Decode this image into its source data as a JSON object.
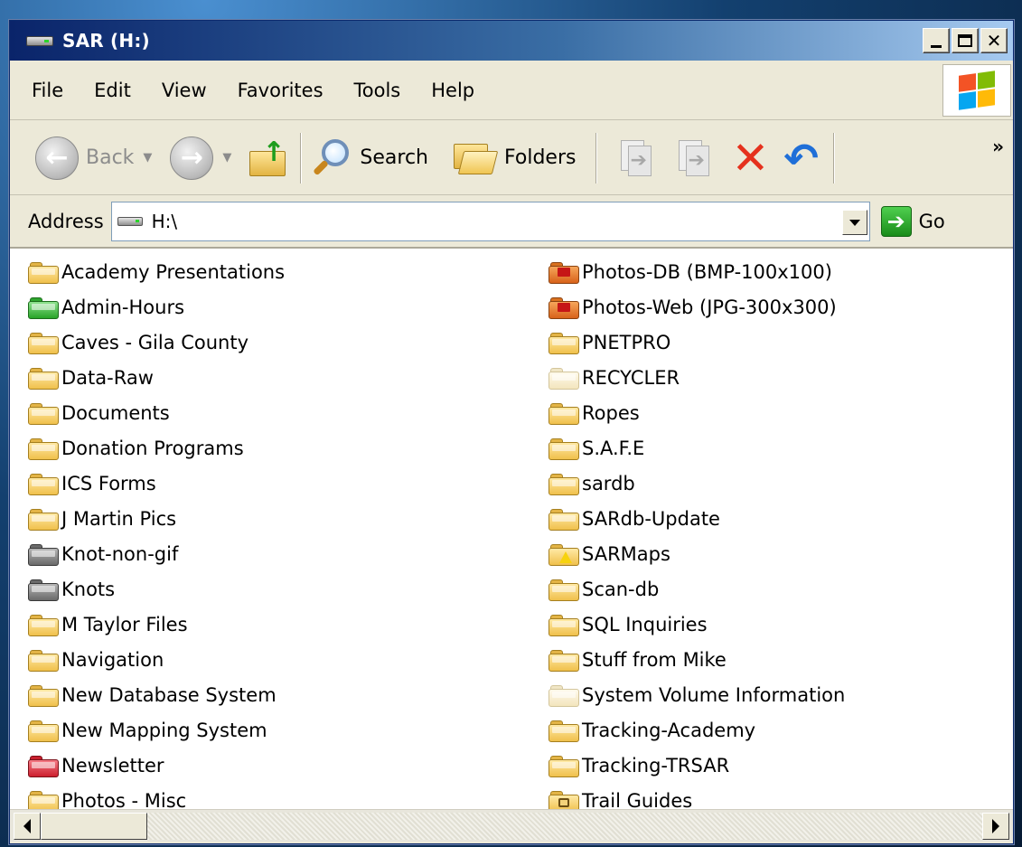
{
  "window": {
    "title": "SAR (H:)"
  },
  "menu": [
    "File",
    "Edit",
    "View",
    "Favorites",
    "Tools",
    "Help"
  ],
  "toolbar": {
    "back": "Back",
    "search": "Search",
    "folders": "Folders",
    "more": "»"
  },
  "address": {
    "label": "Address",
    "path": "H:\\",
    "go": "Go"
  },
  "folders_left": [
    {
      "name": "Academy Presentations",
      "icon": "folder-icon"
    },
    {
      "name": "Admin-Hours",
      "icon": "green-folder-icon"
    },
    {
      "name": "Caves - Gila County",
      "icon": "folder-icon"
    },
    {
      "name": "Data-Raw",
      "icon": "folder-icon"
    },
    {
      "name": "Documents",
      "icon": "folder-icon"
    },
    {
      "name": "Donation Programs",
      "icon": "folder-icon"
    },
    {
      "name": "ICS Forms",
      "icon": "folder-icon"
    },
    {
      "name": "J Martin Pics",
      "icon": "folder-icon"
    },
    {
      "name": "Knot-non-gif",
      "icon": "gray-folder-icon"
    },
    {
      "name": "Knots",
      "icon": "gray-folder-icon"
    },
    {
      "name": "M Taylor Files",
      "icon": "folder-icon"
    },
    {
      "name": "Navigation",
      "icon": "folder-icon"
    },
    {
      "name": "New Database System",
      "icon": "folder-icon"
    },
    {
      "name": "New Mapping System",
      "icon": "folder-icon"
    },
    {
      "name": "Newsletter",
      "icon": "red-folder-icon"
    },
    {
      "name": "Photos - Misc",
      "icon": "folder-icon"
    }
  ],
  "folders_right": [
    {
      "name": "Photos-DB (BMP-100x100)",
      "icon": "photo-folder-icon"
    },
    {
      "name": "Photos-Web (JPG-300x300)",
      "icon": "photo-folder-icon"
    },
    {
      "name": "PNETPRO",
      "icon": "folder-icon"
    },
    {
      "name": "RECYCLER",
      "icon": "hidden-folder-icon"
    },
    {
      "name": "Ropes",
      "icon": "folder-icon"
    },
    {
      "name": "S.A.F.E",
      "icon": "folder-icon"
    },
    {
      "name": "sardb",
      "icon": "folder-icon"
    },
    {
      "name": "SARdb-Update",
      "icon": "folder-icon"
    },
    {
      "name": "SARMaps",
      "icon": "warning-folder-icon"
    },
    {
      "name": "Scan-db",
      "icon": "folder-icon"
    },
    {
      "name": "SQL Inquiries",
      "icon": "folder-icon"
    },
    {
      "name": "Stuff from Mike",
      "icon": "folder-icon"
    },
    {
      "name": "System Volume Information",
      "icon": "hidden-folder-icon"
    },
    {
      "name": "Tracking-Academy",
      "icon": "folder-icon"
    },
    {
      "name": "Tracking-TRSAR",
      "icon": "folder-icon"
    },
    {
      "name": "Trail Guides",
      "icon": "locked-folder-icon"
    }
  ],
  "colors": {
    "titlebar_start": "#0a246a",
    "titlebar_end": "#a6caf0",
    "window_face": "#ece9d8",
    "content_bg": "#ffffff",
    "delete_red": "#e5311d",
    "undo_blue": "#1f6fd8",
    "go_green": "#1a8c1a"
  }
}
